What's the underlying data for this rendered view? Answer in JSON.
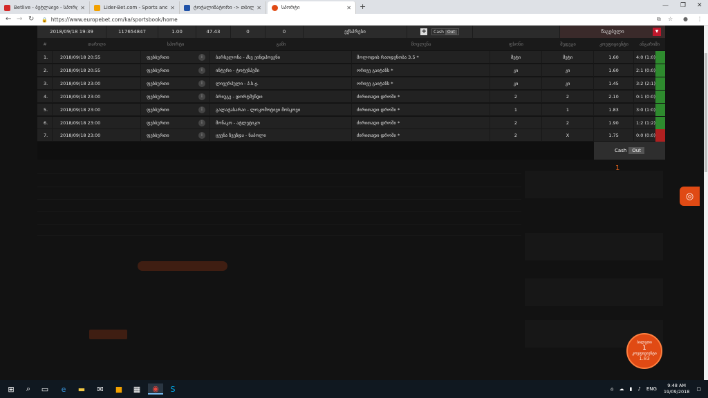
{
  "browser": {
    "tabs": [
      {
        "title": "Betlive - ბეტლაივი - სპორტი",
        "color": "#d42a2a"
      },
      {
        "title": "Lider-Bet.com - Sports and Casi",
        "color": "#f2a100"
      },
      {
        "title": "ტოტალიზატორი -> თბილის",
        "color": "#2052a8"
      },
      {
        "title": "სპორტი",
        "color": "#e04a14"
      }
    ],
    "url": "https://www.europebet.com/ka/sportsbook/home"
  },
  "bet_header": {
    "date": "2018/09/18 19:39",
    "id": "117654847",
    "stake": "1.00",
    "odds": "47.43",
    "won": "0",
    "payout": "0",
    "type": "ექსპრესი",
    "cash": "Cash",
    "out": "Out",
    "status": "წაგებული"
  },
  "columns": [
    "#",
    "თარიღი",
    "სპორტი",
    "გამი",
    "მოვლენა",
    "ფსონი",
    "შედეგი",
    "კოეფიციენტი",
    "ანგარიში"
  ],
  "rows": [
    {
      "n": "1.",
      "date": "2018/09/18 20:55",
      "sport": "ფეხბურთი",
      "match": "ბარსელონა - პსვ ეინდჰოვენი",
      "event": "მოლოდის რაოდენობა 3.5 *",
      "bet": "მეტი",
      "result": "მეტი",
      "odds": "1.60",
      "score": "4:0 (1:0)",
      "status": "win"
    },
    {
      "n": "2.",
      "date": "2018/09/18 20:55",
      "sport": "ფეხბურთი",
      "match": "ინტერი - ტოტენჰემი",
      "event": "ორივე გაიტანს *",
      "bet": "კი",
      "result": "კი",
      "odds": "1.60",
      "score": "2:1 (0:0)",
      "status": "win"
    },
    {
      "n": "3.",
      "date": "2018/09/18 23:00",
      "sport": "ფეხბურთი",
      "match": "ლივერპული - პ.ს.ჟ.",
      "event": "ორივე გაიტანს *",
      "bet": "კი",
      "result": "კი",
      "odds": "1.45",
      "score": "3:2 (2:1)",
      "status": "win"
    },
    {
      "n": "4.",
      "date": "2018/09/18 23:00",
      "sport": "ფეხბურთი",
      "match": "ბრიუგე - დორტმუნდი",
      "event": "ძირითადი დროში *",
      "bet": "2",
      "result": "2",
      "odds": "2.10",
      "score": "0:1 (0:0)",
      "status": "win"
    },
    {
      "n": "5.",
      "date": "2018/09/18 23:00",
      "sport": "ფეხბურთი",
      "match": "გალატასარაი - ლოკომოტივი მოსკოვი",
      "event": "ძირითადი დროში *",
      "bet": "1",
      "result": "1",
      "odds": "1.83",
      "score": "3:0 (1:0)",
      "status": "win"
    },
    {
      "n": "6.",
      "date": "2018/09/18 23:00",
      "sport": "ფეხბურთი",
      "match": "მონაკო - ატლეტიკო",
      "event": "ძირითადი დროში *",
      "bet": "2",
      "result": "2",
      "odds": "1.90",
      "score": "1:2 (1:2)",
      "status": "win"
    },
    {
      "n": "7.",
      "date": "2018/09/18 23:00",
      "sport": "ფეხბურთი",
      "match": "ცვენა ზვეზდა - ნაპოლი",
      "event": "ძირითადი დროში *",
      "bet": "2",
      "result": "X",
      "odds": "1.75",
      "score": "0:0 (0:0)",
      "status": "lose"
    }
  ],
  "footer": {
    "cash": "Cash",
    "out": "Out"
  },
  "overlay": {
    "counter": "1",
    "betslip_label": "ბილეთი",
    "betslip_count": "1",
    "betslip_sub": "კოეფიციენტი",
    "betslip_odds": "1.83"
  },
  "taskbar": {
    "lang": "ENG",
    "time": "9:48 AM",
    "date": "19/09/2018"
  },
  "colors": {
    "accent": "#e04a14",
    "win": "#2e8b2e",
    "lose": "#b02020"
  }
}
